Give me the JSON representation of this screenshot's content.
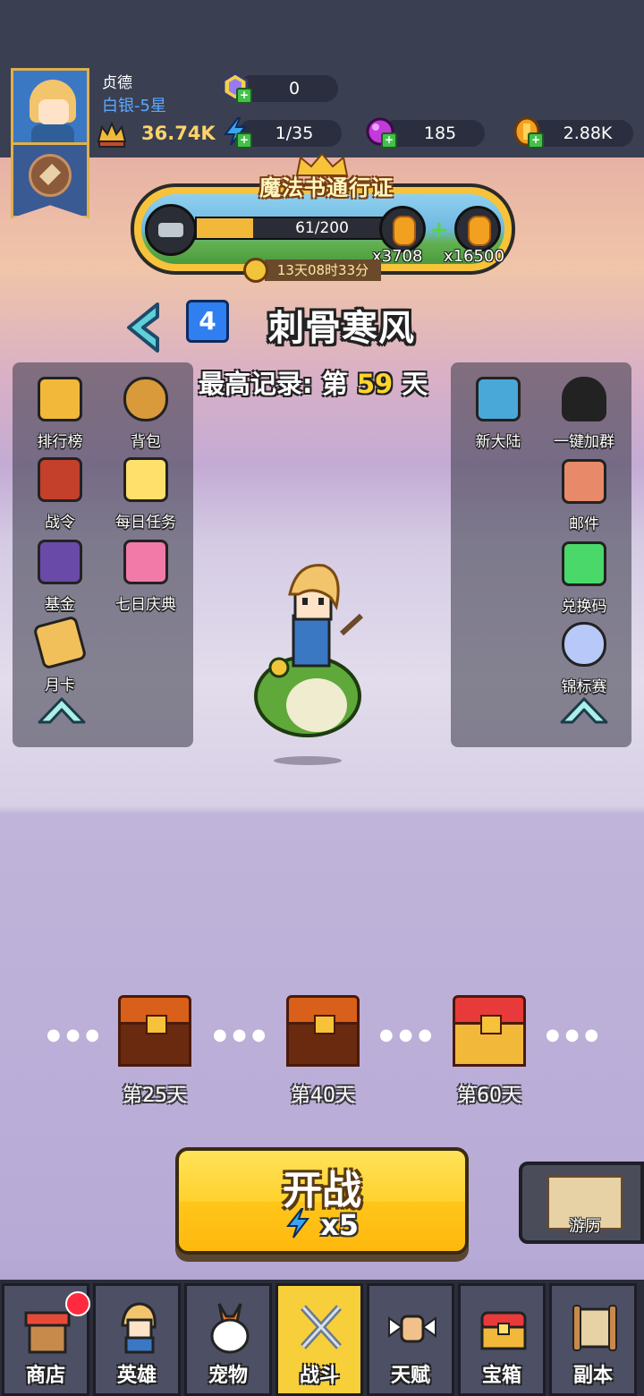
{
  "player": {
    "name": "贞德",
    "rank": "白银-5星",
    "power": "36.74K"
  },
  "resources": {
    "gems": "0",
    "energy": "1/35",
    "orbs": "185",
    "gold": "2.88K"
  },
  "pass": {
    "title": "魔法书通行证",
    "progress_text": "61/200",
    "progress_fraction": 0.305,
    "reward_left": "x3708",
    "reward_right": "x16500",
    "timer": "13天08时33分"
  },
  "level": {
    "number": "4",
    "name": "刺骨寒风",
    "record_prefix": "最高记录: 第",
    "record_day": "59",
    "record_suffix": "天"
  },
  "left_menu": [
    {
      "label": "排行榜"
    },
    {
      "label": "背包"
    },
    {
      "label": "战令"
    },
    {
      "label": "每日任务"
    },
    {
      "label": "基金"
    },
    {
      "label": "七日庆典"
    },
    {
      "label": "月卡"
    }
  ],
  "right_menu": [
    {
      "label": "新大陆"
    },
    {
      "label": "一键加群"
    },
    {
      "label": "邮件"
    },
    {
      "label": "兑换码"
    },
    {
      "label": "锦标赛"
    }
  ],
  "chests": [
    {
      "label": "第25天"
    },
    {
      "label": "第40天"
    },
    {
      "label": "第60天"
    }
  ],
  "start": {
    "label": "开战",
    "cost": "x5"
  },
  "travel": {
    "label": "游历"
  },
  "nav": [
    {
      "label": "商店"
    },
    {
      "label": "英雄"
    },
    {
      "label": "宠物"
    },
    {
      "label": "战斗"
    },
    {
      "label": "天赋"
    },
    {
      "label": "宝箱"
    },
    {
      "label": "副本"
    }
  ]
}
